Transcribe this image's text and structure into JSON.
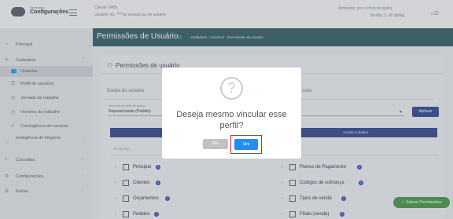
{
  "topbar": {
    "logo_sub": "Financeiro",
    "logo_title": "Configurações",
    "client": "Cliente: 8489",
    "user": "Usuário: es. ****no usuario.ou de usuário",
    "ambiente": "Ambiente: pro   o (Hub de   ação)",
    "versao": "Versão: 2  .90   abling"
  },
  "sidebar": {
    "items": [
      {
        "icon": "⌂",
        "label": "Principal"
      },
      {
        "icon": "✎",
        "label": "Cadastros",
        "chevron": "⌃"
      },
      {
        "icon": "👥",
        "label": "Usuários"
      },
      {
        "icon": "☰",
        "label": "Perfil de usuários"
      },
      {
        "icon": "◷",
        "label": "Jornada de trabalho"
      },
      {
        "icon": "◷",
        "label": "Horários de trabalho"
      },
      {
        "icon": "✔",
        "label": "Contingência de campos"
      },
      {
        "icon": "♡",
        "label": "Inteligência de Negócio",
        "chevron": "›"
      },
      {
        "icon": "⌕",
        "label": "Consultas",
        "chevron": "›"
      },
      {
        "icon": "⚙",
        "label": "Configurações",
        "chevron": "›"
      },
      {
        "icon": "⊕",
        "label": "Extras",
        "chevron": "›"
      }
    ]
  },
  "header": {
    "title": "Permissões de Usuário",
    "breadcrumb": "- Cadastros - Usuários - Permissões de usuário"
  },
  "card": {
    "title": "Permissões de usuário",
    "tab_left": "Dados do usuário",
    "tab_right": "ssos",
    "select_label": "Selecione um perfil de acesso",
    "select_value": "Representante (Padrão)",
    "apply_label": "Aplicar",
    "right_header": "Acesso a dados",
    "search_placeholder": "Pesquisar..."
  },
  "permissions_left": [
    {
      "label": "Principal"
    },
    {
      "label": "Clientes"
    },
    {
      "label": "Orçamentos"
    },
    {
      "label": "Pedidos"
    }
  ],
  "permissions_right": [
    {
      "label": "Planos de Pagamento"
    },
    {
      "label": "Códigos de cobrança"
    },
    {
      "label": "Tipos de venda"
    },
    {
      "label": "Filiais (venda)"
    }
  ],
  "save_label": "Salvar Permissões",
  "modal": {
    "icon": "?",
    "message": "Deseja mesmo vincular esse perfil?",
    "no_label": "Não",
    "yes_label": "Sim"
  },
  "colors": {
    "header": "#3e5f66",
    "primary_blue": "#1f8ff2",
    "highlight_red": "#e0252a",
    "save_green": "#4c8a52"
  }
}
